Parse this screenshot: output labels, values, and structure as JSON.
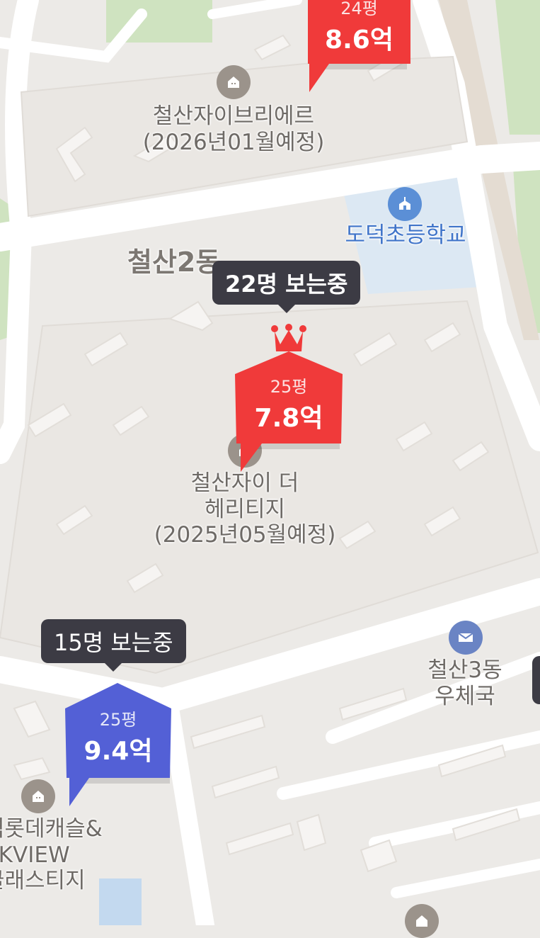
{
  "colors": {
    "map_background": "#eceae7",
    "road": "#ffffff",
    "park": "#cfe3c0",
    "water": "#c3d9ef",
    "school_area": "#dce8f3",
    "building": "#f6f4f2",
    "marker_red": "#f03a3a",
    "marker_blue": "#5360d6",
    "tooltip_bg": "#3c3b44"
  },
  "area_label": "철산2동",
  "pois": [
    {
      "icon": "apartment-icon",
      "lines": [
        "철산자이브리에르",
        "(2026년01월예정)"
      ]
    },
    {
      "icon": "apartment-icon",
      "lines": [
        "철산자이 더",
        "헤리티지",
        "(2025년05월예정)"
      ]
    },
    {
      "icon": "apartment-icon",
      "lines": [
        "역롯데캐슬&",
        "SKVIEW",
        "클래스티지"
      ]
    },
    {
      "icon": "school-icon",
      "lines": [
        "도덕초등학교"
      ]
    },
    {
      "icon": "post-office-icon",
      "lines": [
        "철산3동",
        "우체국"
      ]
    }
  ],
  "markers": [
    {
      "color": "red",
      "pyeong": "24평",
      "price": "8.6억",
      "crown": false
    },
    {
      "color": "red",
      "pyeong": "25평",
      "price": "7.8억",
      "crown": true
    },
    {
      "color": "blue",
      "pyeong": "25평",
      "price": "9.4억",
      "crown": false
    }
  ],
  "tooltips": [
    {
      "text": "22명 보는중"
    },
    {
      "text": "15명 보는중"
    }
  ]
}
